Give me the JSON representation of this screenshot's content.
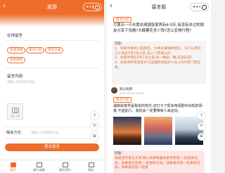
{
  "left": {
    "title": "旅游",
    "capsule": {
      "dots": "•••"
    },
    "location_label": "在线留言",
    "category_chips": [
      "旅游攻略",
      "景点介绍",
      "景区交通",
      "其他相关"
    ],
    "content_label": "留言内容:",
    "content_placeholder": "请输入您的留言内容",
    "upload_label": "点击上传",
    "contact_label": "联系方式:",
    "contact_placeholder": "请输入您的联系方式",
    "submit_label": "提交留言",
    "tabs": [
      {
        "label": "首页",
        "active": true
      },
      {
        "label": "旅行攻略",
        "active": false
      },
      {
        "label": "最近预约",
        "active": false
      },
      {
        "label": "我的",
        "active": false
      }
    ],
    "accent_color": "#ee6d2b"
  },
  "right": {
    "title": "留言板",
    "capsule": {
      "dots": "•••"
    },
    "tag1": "景点介绍",
    "question": "打算五一小长假去濒湖张家界玩4-5天,有没有去过的朋友分享下攻略?大概要花多少钱?怎么安排行程?",
    "reply1": {
      "label": "回复:",
      "items": [
        "1、张家界森林公园景区、大峡谷玻璃桥景区、天门山景区三大景区5月1号之前,成人门票第五折;",
        "2、张家界景区5月1号之前,住一晚送一晚,先送先得!",
        "3、张家界所有景区针对全国所有医护人员,2020年门票全免。"
      ]
    },
    "user": {
      "name": "默认昵称",
      "date": "2020-04-20 15:00"
    },
    "tag2": "景点介绍",
    "post2": "湖南张家界是我去的地方,还打卡了很多电视剧中出现的场景,不虚此行。有机会一定要带家人来这玩。",
    "reply2": {
      "label": "回复:",
      "text": "感谢您的留言支持,那么就要跟着张家界旅游,一起重新出发。如果喜欢旅游,一起重新出发。如果喜欢就一起重新出发。如果喜欢就一起重"
    },
    "accent_color": "#ee6d2b"
  }
}
